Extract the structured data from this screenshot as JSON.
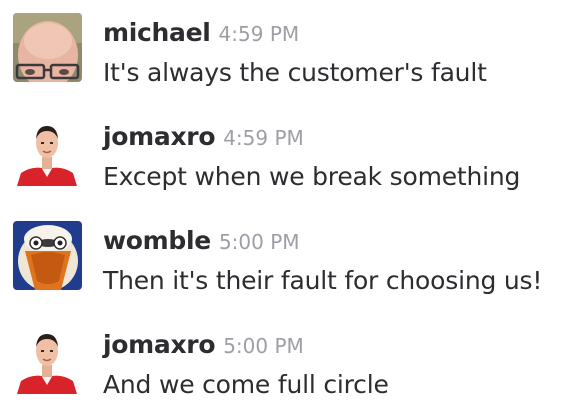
{
  "messages": [
    {
      "author": "michael",
      "time": "4:59 PM",
      "text": "It's always the customer's fault",
      "avatar_icon": "bald-man-glasses-avatar"
    },
    {
      "author": "jomaxro",
      "time": "4:59 PM",
      "text": "Except when we break something",
      "avatar_icon": "man-red-shirt-avatar"
    },
    {
      "author": "womble",
      "time": "5:00 PM",
      "text": "Then it's their fault for choosing us!",
      "avatar_icon": "womble-creature-avatar"
    },
    {
      "author": "jomaxro",
      "time": "5:00 PM",
      "text": "And we come full circle",
      "avatar_icon": "man-red-shirt-avatar"
    }
  ],
  "colors": {
    "author": "#2c2d30",
    "timestamp": "#9e9ea6",
    "shirt_red": "#d9232b",
    "womble_blue": "#1f3d8c"
  }
}
